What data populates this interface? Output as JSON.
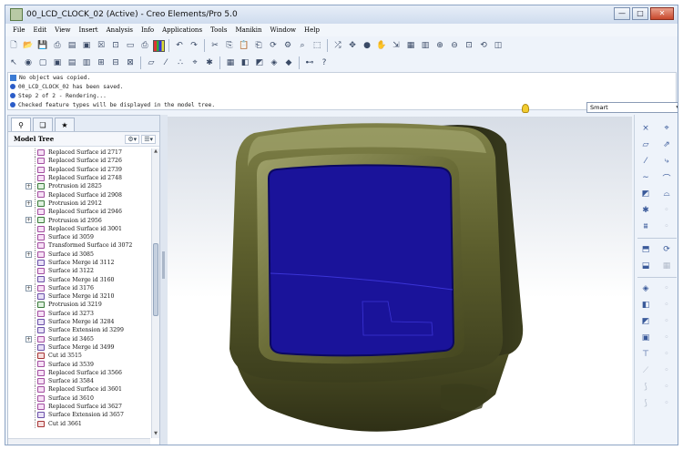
{
  "window": {
    "title": "00_LCD_CLOCK_02 (Active) - Creo Elements/Pro 5.0",
    "minimize": "—",
    "maximize": "□",
    "close": "✕"
  },
  "menu": [
    "File",
    "Edit",
    "View",
    "Insert",
    "Analysis",
    "Info",
    "Applications",
    "Tools",
    "Manikin",
    "Window",
    "Help"
  ],
  "messages": [
    {
      "icon": "doc",
      "text": "No object was copied."
    },
    {
      "icon": "dot",
      "text": "00_LCD_CLOCK_02 has been saved."
    },
    {
      "icon": "dot",
      "text": "Step 2 of 2 - Rendering..."
    },
    {
      "icon": "dot",
      "text": "Checked feature types will be displayed in the model tree."
    }
  ],
  "filter": {
    "value": "Smart"
  },
  "model_tree": {
    "title": "Model Tree",
    "settings_label": "⚙▾",
    "show_label": "☰▾",
    "items": [
      {
        "label": "Replaced Surface id 2717",
        "type": "replaced",
        "expand": false
      },
      {
        "label": "Replaced Surface id 2726",
        "type": "replaced",
        "expand": false
      },
      {
        "label": "Replaced Surface id 2739",
        "type": "replaced",
        "expand": false
      },
      {
        "label": "Replaced Surface id 2748",
        "type": "replaced",
        "expand": false
      },
      {
        "label": "Protrusion id 2825",
        "type": "protrusion",
        "expand": true
      },
      {
        "label": "Replaced Surface id 2908",
        "type": "replaced",
        "expand": false
      },
      {
        "label": "Protrusion id 2912",
        "type": "protrusion",
        "expand": true
      },
      {
        "label": "Replaced Surface id 2946",
        "type": "replaced",
        "expand": false
      },
      {
        "label": "Protrusion id 2956",
        "type": "protrusion",
        "expand": true
      },
      {
        "label": "Replaced Surface id 3001",
        "type": "replaced",
        "expand": false
      },
      {
        "label": "Surface id 3059",
        "type": "surface",
        "expand": false
      },
      {
        "label": "Transformed Surface id 3072",
        "type": "surface",
        "expand": false
      },
      {
        "label": "Surface id 3085",
        "type": "surface",
        "expand": true
      },
      {
        "label": "Surface Merge id 3112",
        "type": "merge",
        "expand": false
      },
      {
        "label": "Surface id 3122",
        "type": "surface",
        "expand": false
      },
      {
        "label": "Surface Merge id 3160",
        "type": "merge",
        "expand": false
      },
      {
        "label": "Surface id 3176",
        "type": "surface",
        "expand": true
      },
      {
        "label": "Surface Merge id 3210",
        "type": "merge",
        "expand": false
      },
      {
        "label": "Protrusion id 3219",
        "type": "protrusion",
        "expand": false
      },
      {
        "label": "Surface id 3273",
        "type": "surface",
        "expand": false
      },
      {
        "label": "Surface Merge id 3284",
        "type": "merge",
        "expand": false
      },
      {
        "label": "Surface Extension id 3299",
        "type": "merge",
        "expand": false
      },
      {
        "label": "Surface id 3465",
        "type": "surface",
        "expand": true
      },
      {
        "label": "Surface Merge id 3499",
        "type": "merge",
        "expand": false
      },
      {
        "label": "Cut id 3515",
        "type": "cut",
        "expand": false
      },
      {
        "label": "Surface id 3539",
        "type": "surface",
        "expand": false
      },
      {
        "label": "Replaced Surface id 3566",
        "type": "replaced",
        "expand": false
      },
      {
        "label": "Surface id 3584",
        "type": "surface",
        "expand": false
      },
      {
        "label": "Replaced Surface id 3601",
        "type": "replaced",
        "expand": false
      },
      {
        "label": "Surface id 3610",
        "type": "surface",
        "expand": false
      },
      {
        "label": "Replaced Surface id 3627",
        "type": "replaced",
        "expand": false
      },
      {
        "label": "Surface Extension id 3657",
        "type": "merge",
        "expand": false
      },
      {
        "label": "Cut id 3661",
        "type": "cut",
        "expand": false
      }
    ]
  },
  "colors": {
    "housing": "#4a4c22",
    "housing_highlight": "#8a8b52",
    "screen": "#1a139a",
    "screen_edge": "#0b0860",
    "bezel": "#5b5d2c"
  },
  "toolbar1_icons": [
    "new",
    "open",
    "save",
    "print",
    "copy",
    "paste",
    "undo",
    "redo",
    "zoom-in",
    "zoom-out",
    "refit",
    "repaint",
    "orient",
    "spin"
  ],
  "toolbar2_icons": [
    "plane",
    "axis",
    "point",
    "csys",
    "sketch",
    "analysis"
  ],
  "right_toolbar_icons": [
    "datum-plane",
    "datum-axis",
    "datum-curve",
    "datum-point",
    "sketch",
    "extrude",
    "revolve",
    "sweep",
    "blend",
    "hole",
    "round",
    "chamfer",
    "draft",
    "shell",
    "rib",
    "pattern",
    "mirror",
    "merge",
    "trim",
    "extend",
    "offset",
    "thicken",
    "solidify",
    "copy"
  ]
}
